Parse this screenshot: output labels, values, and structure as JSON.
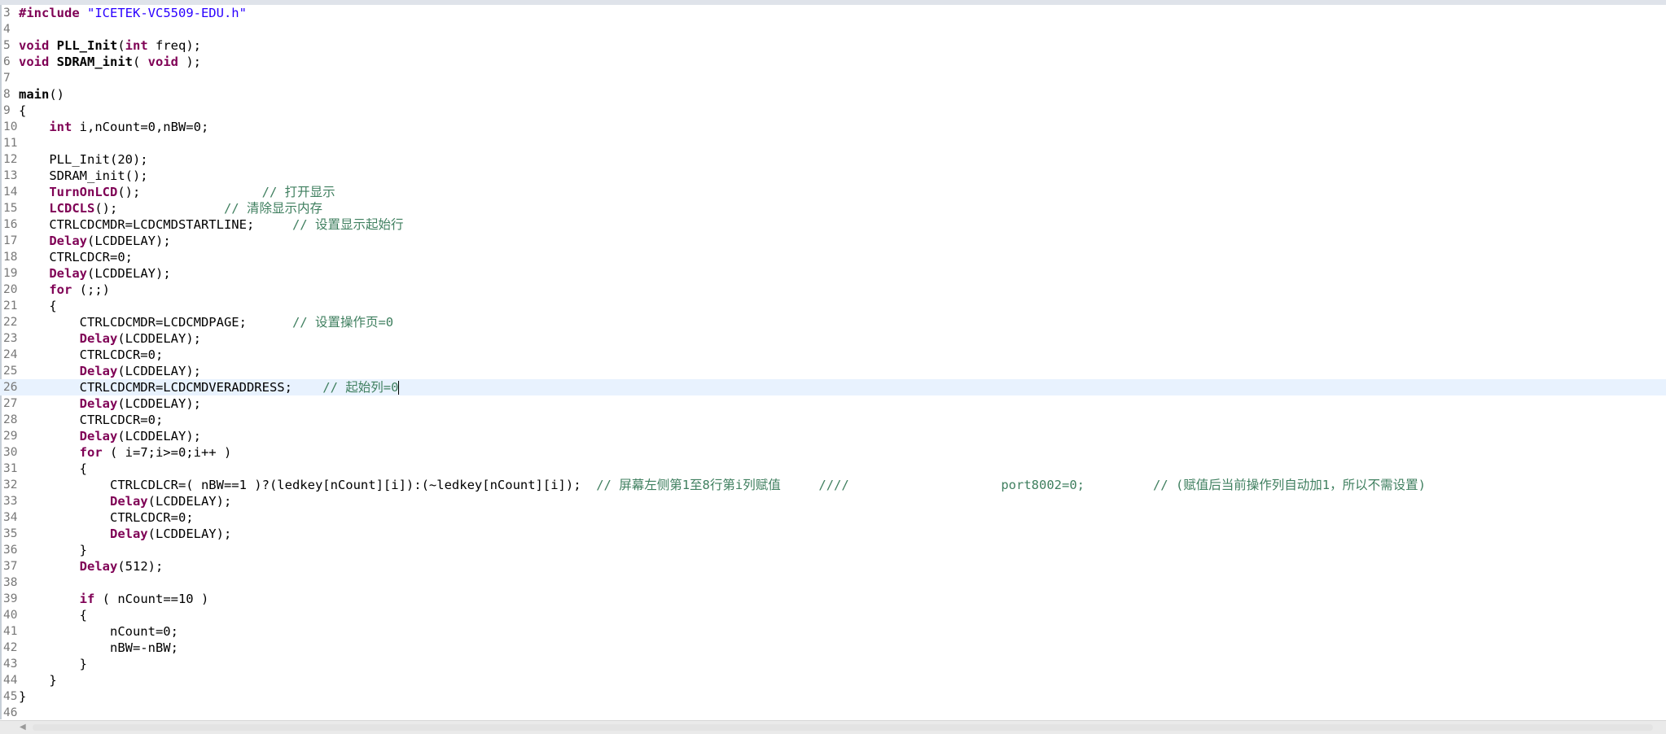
{
  "editor": {
    "file_include": "\"ICETEK-VC5509-EDU.h\"",
    "current_line": 26,
    "lines": [
      {
        "n": "3",
        "t": [
          [
            "kw",
            "#include "
          ],
          [
            "str",
            "\"ICETEK-VC5509-EDU.h\""
          ]
        ]
      },
      {
        "n": "4",
        "t": []
      },
      {
        "n": "5",
        "t": [
          [
            "kw",
            "void "
          ],
          [
            "fn",
            "PLL_Init"
          ],
          [
            "pln",
            "("
          ],
          [
            "kw",
            "int"
          ],
          [
            "pln",
            " freq);"
          ]
        ]
      },
      {
        "n": "6",
        "t": [
          [
            "kw",
            "void "
          ],
          [
            "fn",
            "SDRAM_init"
          ],
          [
            "pln",
            "( "
          ],
          [
            "kw",
            "void"
          ],
          [
            "pln",
            " );"
          ]
        ]
      },
      {
        "n": "7",
        "t": []
      },
      {
        "n": "8",
        "t": [
          [
            "fn",
            "main"
          ],
          [
            "pln",
            "()"
          ]
        ]
      },
      {
        "n": "9",
        "t": [
          [
            "pln",
            "{"
          ]
        ]
      },
      {
        "n": "10",
        "t": [
          [
            "pln",
            "    "
          ],
          [
            "kw",
            "int"
          ],
          [
            "pln",
            " i,nCount=0,nBW=0;"
          ]
        ]
      },
      {
        "n": "11",
        "t": []
      },
      {
        "n": "12",
        "t": [
          [
            "pln",
            "    PLL_Init(20);"
          ]
        ]
      },
      {
        "n": "13",
        "t": [
          [
            "pln",
            "    SDRAM_init();"
          ]
        ]
      },
      {
        "n": "14",
        "t": [
          [
            "pln",
            "    "
          ],
          [
            "kw",
            "TurnOnLCD"
          ],
          [
            "pln",
            "();                "
          ],
          [
            "cmt",
            "// 打开显示"
          ]
        ]
      },
      {
        "n": "15",
        "t": [
          [
            "pln",
            "    "
          ],
          [
            "kw",
            "LCDCLS"
          ],
          [
            "pln",
            "();              "
          ],
          [
            "cmt",
            "// 清除显示内存"
          ]
        ]
      },
      {
        "n": "16",
        "t": [
          [
            "pln",
            "    CTRLCDCMDR=LCDCMDSTARTLINE;     "
          ],
          [
            "cmt",
            "// 设置显示起始行"
          ]
        ]
      },
      {
        "n": "17",
        "t": [
          [
            "pln",
            "    "
          ],
          [
            "kw",
            "Delay"
          ],
          [
            "pln",
            "(LCDDELAY);"
          ]
        ]
      },
      {
        "n": "18",
        "t": [
          [
            "pln",
            "    CTRLCDCR=0;"
          ]
        ]
      },
      {
        "n": "19",
        "t": [
          [
            "pln",
            "    "
          ],
          [
            "kw",
            "Delay"
          ],
          [
            "pln",
            "(LCDDELAY);"
          ]
        ]
      },
      {
        "n": "20",
        "t": [
          [
            "pln",
            "    "
          ],
          [
            "kw",
            "for"
          ],
          [
            "pln",
            " (;;)"
          ]
        ]
      },
      {
        "n": "21",
        "t": [
          [
            "pln",
            "    {"
          ]
        ]
      },
      {
        "n": "22",
        "t": [
          [
            "pln",
            "        CTRLCDCMDR=LCDCMDPAGE;      "
          ],
          [
            "cmt",
            "// 设置操作页=0"
          ]
        ]
      },
      {
        "n": "23",
        "t": [
          [
            "pln",
            "        "
          ],
          [
            "kw",
            "Delay"
          ],
          [
            "pln",
            "(LCDDELAY);"
          ]
        ]
      },
      {
        "n": "24",
        "t": [
          [
            "pln",
            "        CTRLCDCR=0;"
          ]
        ]
      },
      {
        "n": "25",
        "t": [
          [
            "pln",
            "        "
          ],
          [
            "kw",
            "Delay"
          ],
          [
            "pln",
            "(LCDDELAY);"
          ]
        ]
      },
      {
        "n": "26",
        "t": [
          [
            "pln",
            "        CTRLCDCMDR=LCDCMDVERADDRESS;    "
          ],
          [
            "cmt",
            "// 起始列=0"
          ]
        ]
      },
      {
        "n": "27",
        "t": [
          [
            "pln",
            "        "
          ],
          [
            "kw",
            "Delay"
          ],
          [
            "pln",
            "(LCDDELAY);"
          ]
        ]
      },
      {
        "n": "28",
        "t": [
          [
            "pln",
            "        CTRLCDCR=0;"
          ]
        ]
      },
      {
        "n": "29",
        "t": [
          [
            "pln",
            "        "
          ],
          [
            "kw",
            "Delay"
          ],
          [
            "pln",
            "(LCDDELAY);"
          ]
        ]
      },
      {
        "n": "30",
        "t": [
          [
            "pln",
            "        "
          ],
          [
            "kw",
            "for"
          ],
          [
            "pln",
            " ( i=7;i>=0;i++ )"
          ]
        ]
      },
      {
        "n": "31",
        "t": [
          [
            "pln",
            "        {"
          ]
        ]
      },
      {
        "n": "32",
        "t": [
          [
            "pln",
            "            CTRLCDLCR=( nBW==1 )?(ledkey[nCount][i]):(~ledkey[nCount][i]);  "
          ],
          [
            "cmt",
            "// 屏幕左侧第1至8行第i列赋值     ////                    port8002=0;         // (赋值后当前操作列自动加1，所以不需设置)"
          ]
        ]
      },
      {
        "n": "33",
        "t": [
          [
            "pln",
            "            "
          ],
          [
            "kw",
            "Delay"
          ],
          [
            "pln",
            "(LCDDELAY);"
          ]
        ]
      },
      {
        "n": "34",
        "t": [
          [
            "pln",
            "            CTRLCDCR=0;"
          ]
        ]
      },
      {
        "n": "35",
        "t": [
          [
            "pln",
            "            "
          ],
          [
            "kw",
            "Delay"
          ],
          [
            "pln",
            "(LCDDELAY);"
          ]
        ]
      },
      {
        "n": "36",
        "t": [
          [
            "pln",
            "        }"
          ]
        ]
      },
      {
        "n": "37",
        "t": [
          [
            "pln",
            "        "
          ],
          [
            "kw",
            "Delay"
          ],
          [
            "pln",
            "(512);"
          ]
        ]
      },
      {
        "n": "38",
        "t": []
      },
      {
        "n": "39",
        "t": [
          [
            "pln",
            "        "
          ],
          [
            "kw",
            "if"
          ],
          [
            "pln",
            " ( nCount==10 )"
          ]
        ]
      },
      {
        "n": "40",
        "t": [
          [
            "pln",
            "        {"
          ]
        ]
      },
      {
        "n": "41",
        "t": [
          [
            "pln",
            "            nCount=0;"
          ]
        ]
      },
      {
        "n": "42",
        "t": [
          [
            "pln",
            "            nBW=-nBW;"
          ]
        ]
      },
      {
        "n": "43",
        "t": [
          [
            "pln",
            "        }"
          ]
        ]
      },
      {
        "n": "44",
        "t": [
          [
            "pln",
            "    }"
          ]
        ]
      },
      {
        "n": "45",
        "t": [
          [
            "pln",
            "}"
          ]
        ]
      },
      {
        "n": "46",
        "t": []
      }
    ]
  },
  "scrollbar": {
    "left_arrow_icon": "triangle-left-icon",
    "left_arrow_glyph": "◀"
  }
}
